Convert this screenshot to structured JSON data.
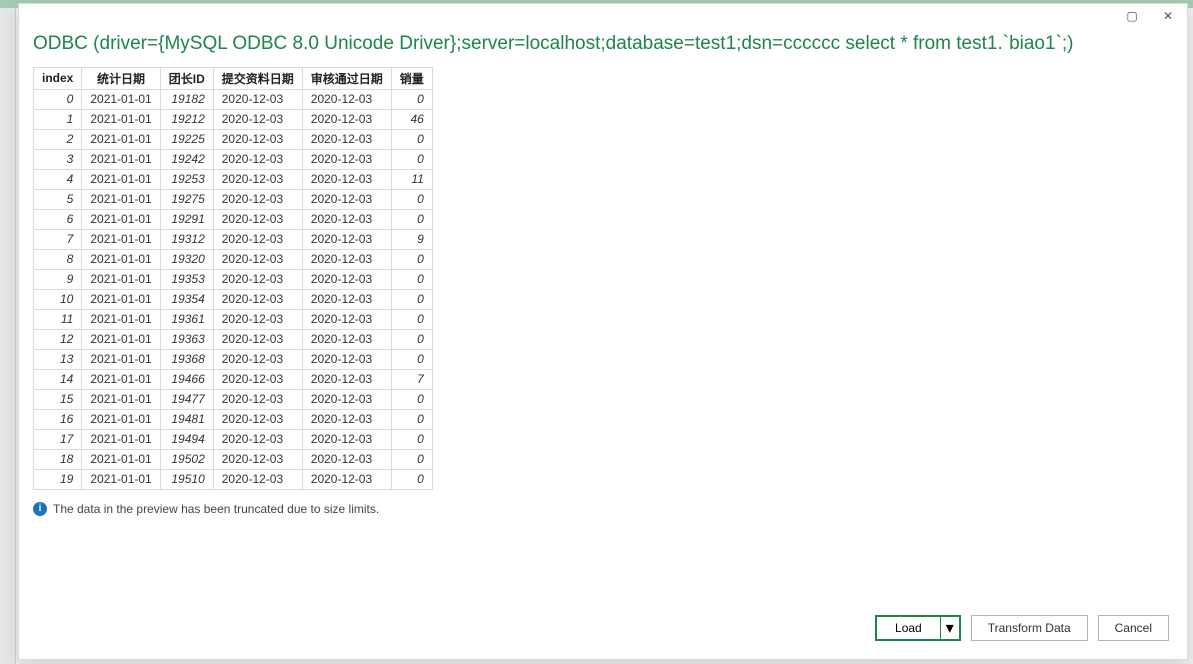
{
  "dialog": {
    "title": "ODBC (driver={MySQL ODBC 8.0 Unicode Driver};server=localhost;database=test1;dsn=cccccc select * from test1.`biao1`;)",
    "truncation_note": "The data in the preview has been truncated due to size limits."
  },
  "columns": [
    "index",
    "统计日期",
    "团长ID",
    "提交资料日期",
    "审核通过日期",
    "销量"
  ],
  "rows": [
    {
      "index": 0,
      "stat_date": "2021-01-01",
      "leader_id": 19182,
      "submit_date": "2020-12-03",
      "approve_date": "2020-12-03",
      "sales": 0
    },
    {
      "index": 1,
      "stat_date": "2021-01-01",
      "leader_id": 19212,
      "submit_date": "2020-12-03",
      "approve_date": "2020-12-03",
      "sales": 46
    },
    {
      "index": 2,
      "stat_date": "2021-01-01",
      "leader_id": 19225,
      "submit_date": "2020-12-03",
      "approve_date": "2020-12-03",
      "sales": 0
    },
    {
      "index": 3,
      "stat_date": "2021-01-01",
      "leader_id": 19242,
      "submit_date": "2020-12-03",
      "approve_date": "2020-12-03",
      "sales": 0
    },
    {
      "index": 4,
      "stat_date": "2021-01-01",
      "leader_id": 19253,
      "submit_date": "2020-12-03",
      "approve_date": "2020-12-03",
      "sales": 11
    },
    {
      "index": 5,
      "stat_date": "2021-01-01",
      "leader_id": 19275,
      "submit_date": "2020-12-03",
      "approve_date": "2020-12-03",
      "sales": 0
    },
    {
      "index": 6,
      "stat_date": "2021-01-01",
      "leader_id": 19291,
      "submit_date": "2020-12-03",
      "approve_date": "2020-12-03",
      "sales": 0
    },
    {
      "index": 7,
      "stat_date": "2021-01-01",
      "leader_id": 19312,
      "submit_date": "2020-12-03",
      "approve_date": "2020-12-03",
      "sales": 9
    },
    {
      "index": 8,
      "stat_date": "2021-01-01",
      "leader_id": 19320,
      "submit_date": "2020-12-03",
      "approve_date": "2020-12-03",
      "sales": 0
    },
    {
      "index": 9,
      "stat_date": "2021-01-01",
      "leader_id": 19353,
      "submit_date": "2020-12-03",
      "approve_date": "2020-12-03",
      "sales": 0
    },
    {
      "index": 10,
      "stat_date": "2021-01-01",
      "leader_id": 19354,
      "submit_date": "2020-12-03",
      "approve_date": "2020-12-03",
      "sales": 0
    },
    {
      "index": 11,
      "stat_date": "2021-01-01",
      "leader_id": 19361,
      "submit_date": "2020-12-03",
      "approve_date": "2020-12-03",
      "sales": 0
    },
    {
      "index": 12,
      "stat_date": "2021-01-01",
      "leader_id": 19363,
      "submit_date": "2020-12-03",
      "approve_date": "2020-12-03",
      "sales": 0
    },
    {
      "index": 13,
      "stat_date": "2021-01-01",
      "leader_id": 19368,
      "submit_date": "2020-12-03",
      "approve_date": "2020-12-03",
      "sales": 0
    },
    {
      "index": 14,
      "stat_date": "2021-01-01",
      "leader_id": 19466,
      "submit_date": "2020-12-03",
      "approve_date": "2020-12-03",
      "sales": 7
    },
    {
      "index": 15,
      "stat_date": "2021-01-01",
      "leader_id": 19477,
      "submit_date": "2020-12-03",
      "approve_date": "2020-12-03",
      "sales": 0
    },
    {
      "index": 16,
      "stat_date": "2021-01-01",
      "leader_id": 19481,
      "submit_date": "2020-12-03",
      "approve_date": "2020-12-03",
      "sales": 0
    },
    {
      "index": 17,
      "stat_date": "2021-01-01",
      "leader_id": 19494,
      "submit_date": "2020-12-03",
      "approve_date": "2020-12-03",
      "sales": 0
    },
    {
      "index": 18,
      "stat_date": "2021-01-01",
      "leader_id": 19502,
      "submit_date": "2020-12-03",
      "approve_date": "2020-12-03",
      "sales": 0
    },
    {
      "index": 19,
      "stat_date": "2021-01-01",
      "leader_id": 19510,
      "submit_date": "2020-12-03",
      "approve_date": "2020-12-03",
      "sales": 0
    }
  ],
  "footer": {
    "load_label": "Load",
    "transform_label": "Transform Data",
    "cancel_label": "Cancel"
  },
  "icons": {
    "info_glyph": "i",
    "chevron_down": "▾",
    "close_glyph": "✕",
    "restore_glyph": "▢"
  }
}
